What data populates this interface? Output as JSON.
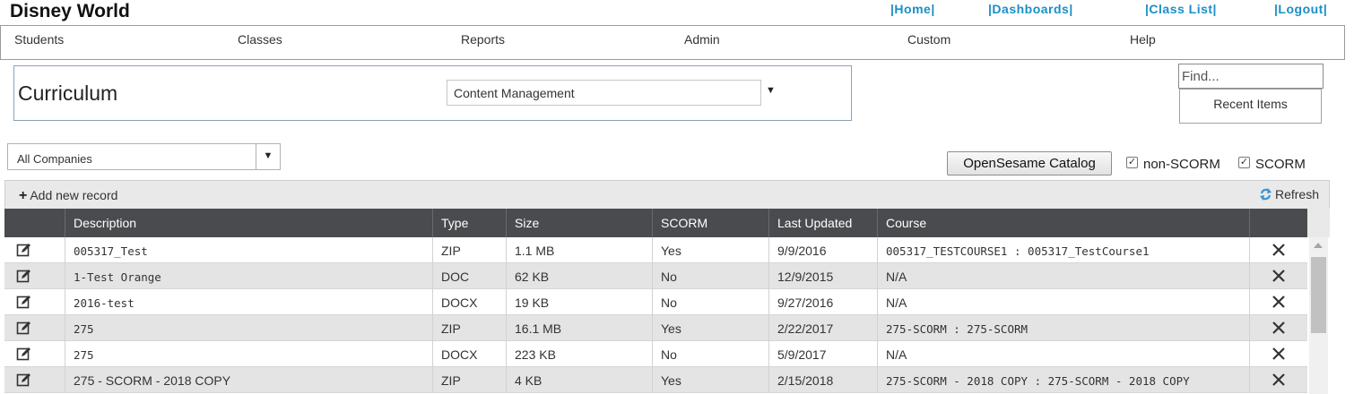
{
  "header": {
    "title": "Disney World",
    "links": [
      "|Home|",
      "|Dashboards|",
      "|Class List|",
      "|Logout|"
    ]
  },
  "nav": {
    "items": [
      "Students",
      "Classes",
      "Reports",
      "Admin",
      "Custom",
      "Help"
    ]
  },
  "curriculum": {
    "title": "Curriculum",
    "selected": "Content Management"
  },
  "search": {
    "placeholder": "Find...",
    "recent_label": "Recent Items"
  },
  "filters": {
    "company": "All Companies",
    "catalog_button": "OpenSesame Catalog",
    "non_scorm_label": "non-SCORM",
    "non_scorm_checked": true,
    "scorm_label": "SCORM",
    "scorm_checked": true
  },
  "toolbar": {
    "add_label": "Add new record",
    "refresh_label": "Refresh"
  },
  "grid": {
    "columns": [
      "Description",
      "Type",
      "Size",
      "SCORM",
      "Last Updated",
      "Course"
    ],
    "rows": [
      {
        "description": "005317_Test",
        "type": "ZIP",
        "size": "1.1 MB",
        "scorm": "Yes",
        "updated": "9/9/2016",
        "course": "005317_TESTCOURSE1 : 005317_TestCourse1"
      },
      {
        "description": "1-Test Orange",
        "type": "DOC",
        "size": "62 KB",
        "scorm": "No",
        "updated": "12/9/2015",
        "course": "N/A"
      },
      {
        "description": "2016-test",
        "type": "DOCX",
        "size": "19 KB",
        "scorm": "No",
        "updated": "9/27/2016",
        "course": "N/A"
      },
      {
        "description": "275",
        "type": "ZIP",
        "size": "16.1 MB",
        "scorm": "Yes",
        "updated": "2/22/2017",
        "course": "275-SCORM : 275-SCORM"
      },
      {
        "description": "275",
        "type": "DOCX",
        "size": "223 KB",
        "scorm": "No",
        "updated": "5/9/2017",
        "course": "N/A"
      },
      {
        "description": "275 - SCORM - 2018 COPY",
        "type": "ZIP",
        "size": "4 KB",
        "scorm": "Yes",
        "updated": "2/15/2018",
        "course": "275-SCORM - 2018 COPY : 275-SCORM - 2018 COPY"
      }
    ]
  },
  "icons": {
    "edit": "edit-icon",
    "delete": "close-icon",
    "refresh": "refresh-icon",
    "add": "plus-icon"
  },
  "colors": {
    "link": "#1a8fc7",
    "grid_header": "#4a4b4e",
    "alt_row": "#e4e4e4"
  }
}
